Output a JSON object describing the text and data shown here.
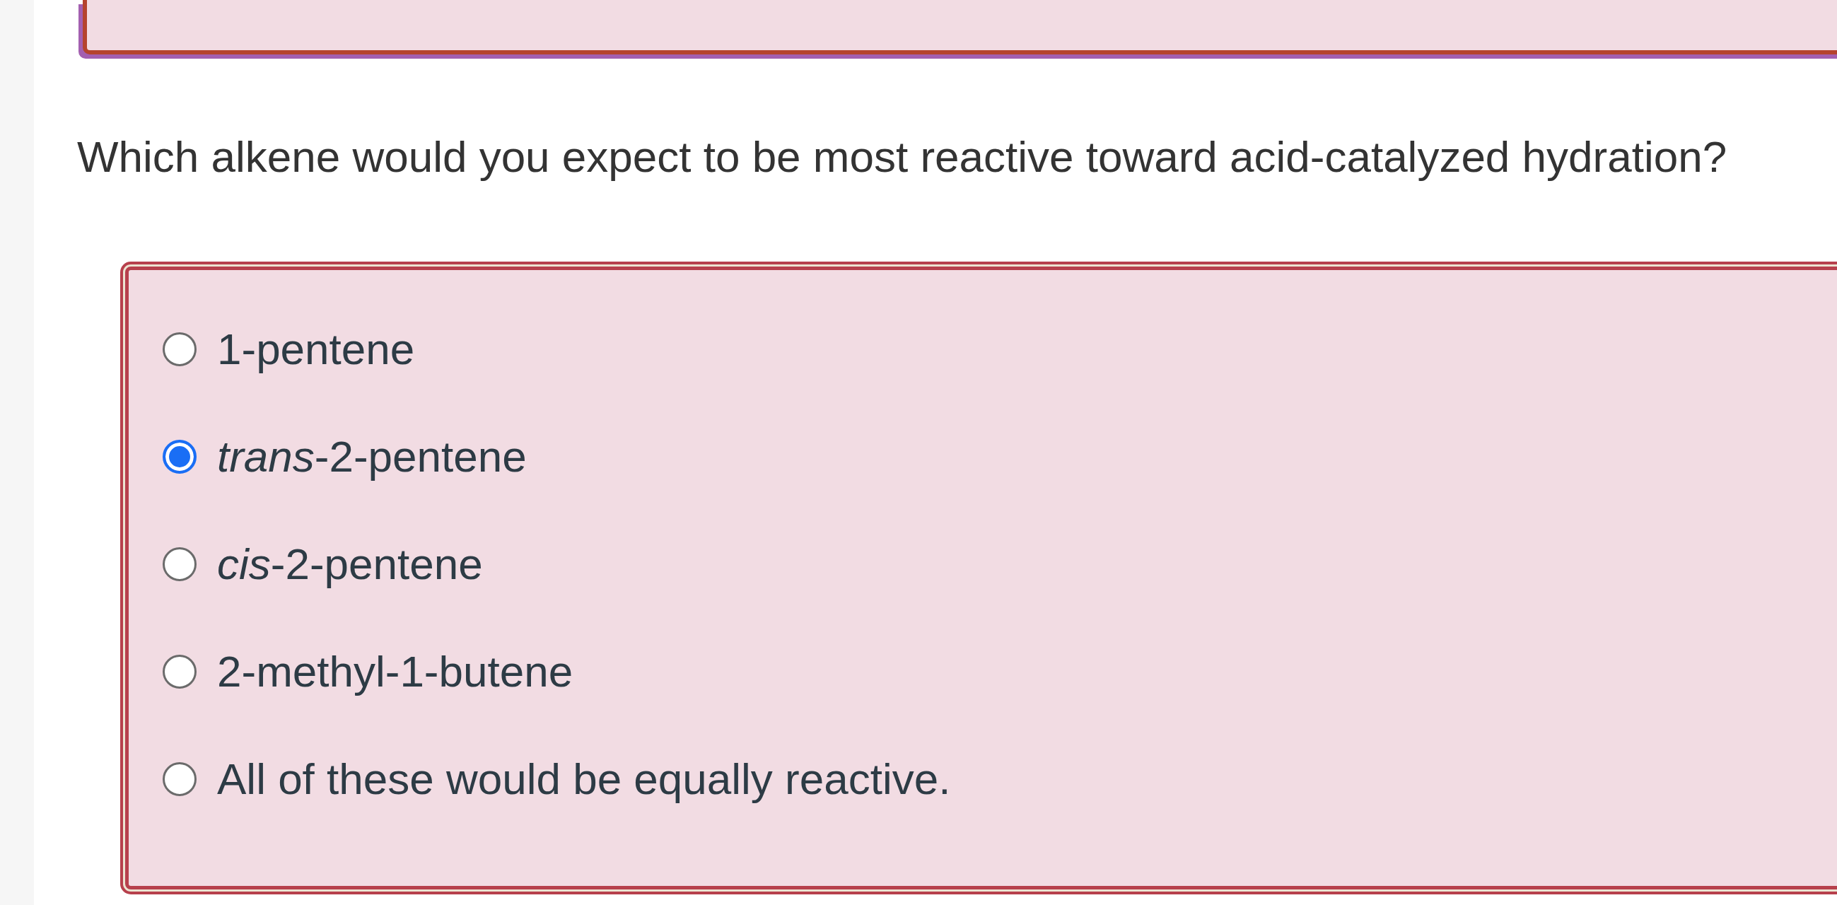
{
  "question": "Which alkene would you expect to be most reactive toward acid-catalyzed hydration?",
  "options": [
    {
      "label": "1-pentene",
      "selected": false
    },
    {
      "label": "*trans*-2-pentene",
      "selected": true
    },
    {
      "label": "*cis*-2-pentene",
      "selected": false
    },
    {
      "label": "2-methyl-1-butene",
      "selected": false
    },
    {
      "label": "All of these would be equally reactive.",
      "selected": false
    }
  ]
}
